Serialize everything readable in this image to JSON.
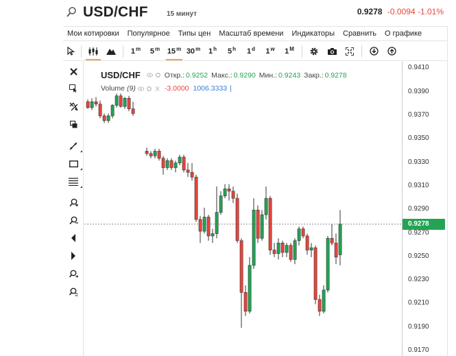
{
  "header": {
    "symbol": "USD/CHF",
    "interval": "15 минут",
    "last_price": "0.9278",
    "change": "-0.0094",
    "change_pct": "-1.01%"
  },
  "menu": {
    "items": [
      "Мои котировки",
      "Популярное",
      "Типы цен",
      "Масштаб времени",
      "Индикаторы",
      "Сравнить",
      "О графике"
    ]
  },
  "toolbar": {
    "timeframes": [
      {
        "num": "1",
        "unit": "m"
      },
      {
        "num": "5",
        "unit": "m"
      },
      {
        "num": "15",
        "unit": "m"
      },
      {
        "num": "30",
        "unit": "m"
      },
      {
        "num": "1",
        "unit": "h"
      },
      {
        "num": "5",
        "unit": "h"
      },
      {
        "num": "1",
        "unit": "d"
      },
      {
        "num": "1",
        "unit": "w"
      },
      {
        "num": "1",
        "unit": "M"
      }
    ],
    "active_timeframe": "15m"
  },
  "legend": {
    "symbol": "USD/CHF",
    "open_label": "Откр.:",
    "open": "0.9252",
    "high_label": "Макс.:",
    "high": "0.9290",
    "low_label": "Мин.:",
    "low": "0.9243",
    "close_label": "Закр.:",
    "close": "0.9278",
    "volume_label": "Volume",
    "volume_period": "(9)",
    "volume_change": "-3.0000",
    "volume_value": "1006.3333"
  },
  "colors": {
    "up": "#24a355",
    "down": "#e8453c",
    "accent": "#f2a43c"
  },
  "chart_data": {
    "type": "candlestick",
    "current_price": 0.9278,
    "ylim": [
      0.917,
      0.942
    ],
    "y_ticks": [
      "0.9410",
      "0.9390",
      "0.9370",
      "0.9350",
      "0.9330",
      "0.9310",
      "0.9290",
      "0.9270",
      "0.9250",
      "0.9230",
      "0.9210",
      "0.9190",
      "0.9170"
    ],
    "segments": [
      {
        "candles": [
          [
            0.9382,
            0.9384,
            0.9376,
            0.9377
          ],
          [
            0.9377,
            0.9385,
            0.9375,
            0.9382
          ],
          [
            0.9382,
            0.9386,
            0.9378,
            0.938
          ],
          [
            0.938,
            0.9383,
            0.9368,
            0.937
          ],
          [
            0.937,
            0.9372,
            0.9364,
            0.9366
          ],
          [
            0.9366,
            0.9372,
            0.9364,
            0.937
          ],
          [
            0.937,
            0.938,
            0.9368,
            0.9379
          ],
          [
            0.9379,
            0.9389,
            0.9377,
            0.9387
          ],
          [
            0.9387,
            0.9389,
            0.9377,
            0.9378
          ],
          [
            0.9378,
            0.9386,
            0.9376,
            0.9385
          ],
          [
            0.9385,
            0.9387,
            0.9374,
            0.9376
          ],
          [
            0.9376,
            0.9382,
            0.937,
            0.9372
          ]
        ]
      },
      {
        "candles": [
          [
            0.934,
            0.9343,
            0.9336,
            0.9338
          ],
          [
            0.9338,
            0.934,
            0.9334,
            0.9336
          ],
          [
            0.9336,
            0.9342,
            0.9334,
            0.934
          ],
          [
            0.934,
            0.9342,
            0.9332,
            0.9334
          ],
          [
            0.9334,
            0.9336,
            0.932,
            0.9326
          ],
          [
            0.9326,
            0.9334,
            0.9324,
            0.9332
          ],
          [
            0.9332,
            0.9334,
            0.9324,
            0.9326
          ],
          [
            0.9326,
            0.9332,
            0.9322,
            0.933
          ],
          [
            0.933,
            0.9337,
            0.9328,
            0.9335
          ],
          [
            0.9335,
            0.9337,
            0.9322,
            0.9324
          ],
          [
            0.9324,
            0.933,
            0.9318,
            0.9322
          ],
          [
            0.9322,
            0.933,
            0.9315,
            0.9318
          ],
          [
            0.9318,
            0.932,
            0.928,
            0.9282
          ],
          [
            0.9282,
            0.9285,
            0.9262,
            0.9272
          ],
          [
            0.9272,
            0.9292,
            0.927,
            0.9284
          ],
          [
            0.9284,
            0.9286,
            0.9264,
            0.9268
          ],
          [
            0.9268,
            0.9274,
            0.9262,
            0.927
          ],
          [
            0.927,
            0.931,
            0.9266,
            0.9288
          ],
          [
            0.9288,
            0.9306,
            0.9286,
            0.9302
          ],
          [
            0.9302,
            0.9312,
            0.93,
            0.9308
          ],
          [
            0.9308,
            0.9312,
            0.9298,
            0.9306
          ],
          [
            0.9306,
            0.931,
            0.9296,
            0.93
          ],
          [
            0.93,
            0.9304,
            0.9262,
            0.9264
          ],
          [
            0.9264,
            0.9266,
            0.919,
            0.922
          ],
          [
            0.922,
            0.9226,
            0.92,
            0.9204
          ],
          [
            0.9204,
            0.925,
            0.9202,
            0.9243
          ],
          [
            0.9243,
            0.93,
            0.924,
            0.929
          ],
          [
            0.929,
            0.9294,
            0.9262,
            0.9266
          ],
          [
            0.9266,
            0.929,
            0.9264,
            0.9286
          ],
          [
            0.9286,
            0.931,
            0.9282,
            0.93
          ],
          [
            0.93,
            0.9302,
            0.9252,
            0.9256
          ],
          [
            0.9256,
            0.9262,
            0.925,
            0.9253
          ],
          [
            0.9253,
            0.9266,
            0.9248,
            0.9262
          ],
          [
            0.9262,
            0.9264,
            0.925,
            0.9254
          ],
          [
            0.9254,
            0.9262,
            0.925,
            0.926
          ],
          [
            0.926,
            0.9262,
            0.9246,
            0.9248
          ],
          [
            0.9248,
            0.9266,
            0.9244,
            0.9264
          ],
          [
            0.9264,
            0.9276,
            0.926,
            0.9274
          ],
          [
            0.9274,
            0.9276,
            0.9266,
            0.9268
          ],
          [
            0.9268,
            0.927,
            0.9252,
            0.9256
          ],
          [
            0.9256,
            0.9262,
            0.925,
            0.9258
          ],
          [
            0.9258,
            0.926,
            0.921,
            0.9214
          ],
          [
            0.9214,
            0.9218,
            0.92,
            0.9204
          ],
          [
            0.9204,
            0.9226,
            0.9202,
            0.9222
          ],
          [
            0.9222,
            0.9268,
            0.922,
            0.9266
          ],
          [
            0.9266,
            0.9278,
            0.926,
            0.9262
          ],
          [
            0.9262,
            0.927,
            0.9244,
            0.925
          ],
          [
            0.9252,
            0.929,
            0.9243,
            0.9278
          ]
        ]
      }
    ]
  }
}
